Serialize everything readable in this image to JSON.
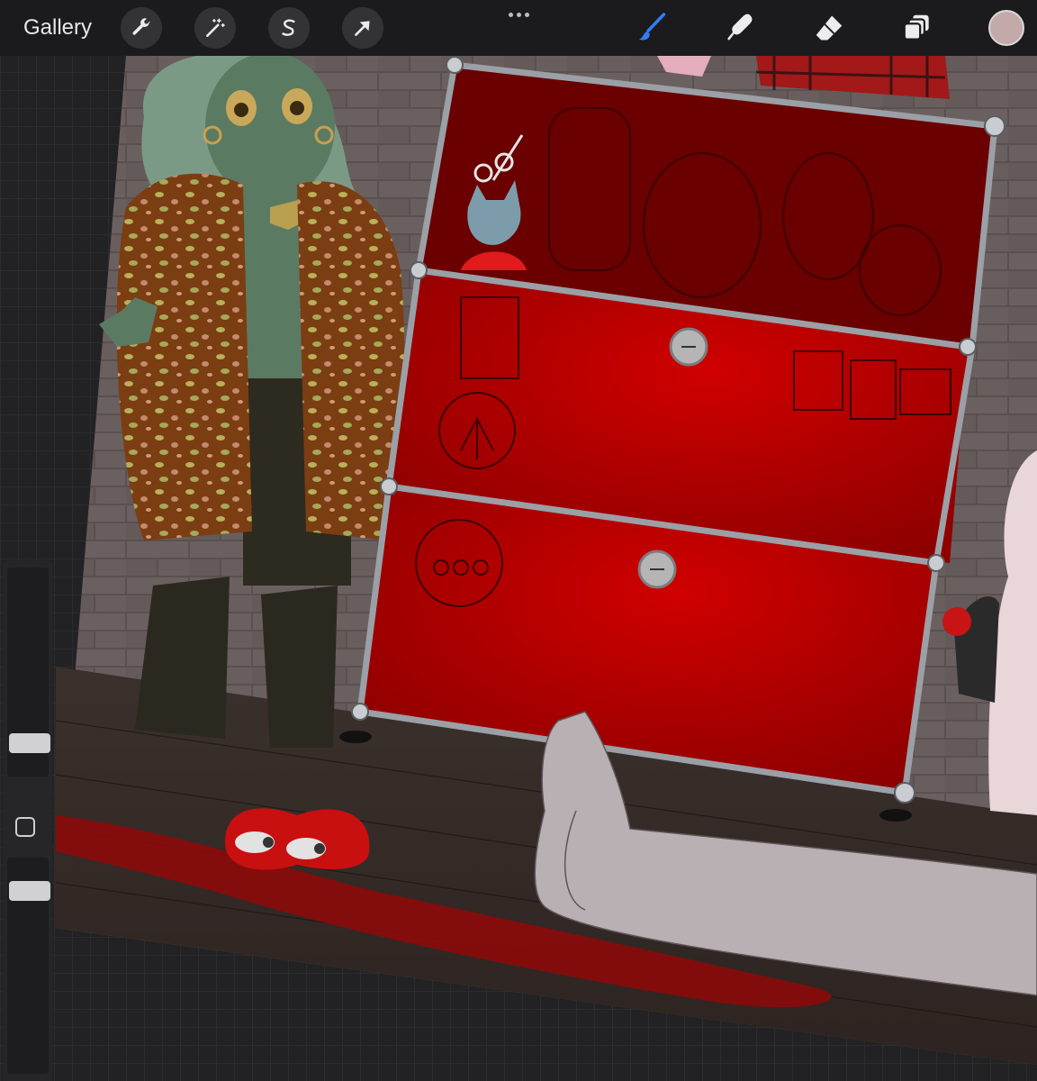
{
  "toolbar": {
    "gallery_label": "Gallery",
    "left_tools": [
      {
        "name": "actions",
        "icon": "wrench-icon"
      },
      {
        "name": "adjustments",
        "icon": "magic-wand-icon"
      },
      {
        "name": "selection",
        "icon": "selection-s-icon"
      },
      {
        "name": "transform",
        "icon": "arrow-cursor-icon"
      }
    ],
    "more_icon": "more-dots-icon",
    "right_tools": [
      {
        "name": "brush",
        "icon": "brush-icon",
        "active": true
      },
      {
        "name": "smudge",
        "icon": "smudge-finger-icon",
        "active": false
      },
      {
        "name": "eraser",
        "icon": "eraser-icon",
        "active": false
      },
      {
        "name": "layers",
        "icon": "layers-icon",
        "active": false
      }
    ],
    "current_color": "#c4a9a9"
  },
  "sidebar": {
    "brush_size_level": 0.55,
    "opacity_level": 0.2,
    "modify_icon": "square-icon"
  },
  "colors": {
    "accent": "#2f7ff7",
    "cabinet_red": "#b50000",
    "background_ui": "#1b1b1d"
  }
}
